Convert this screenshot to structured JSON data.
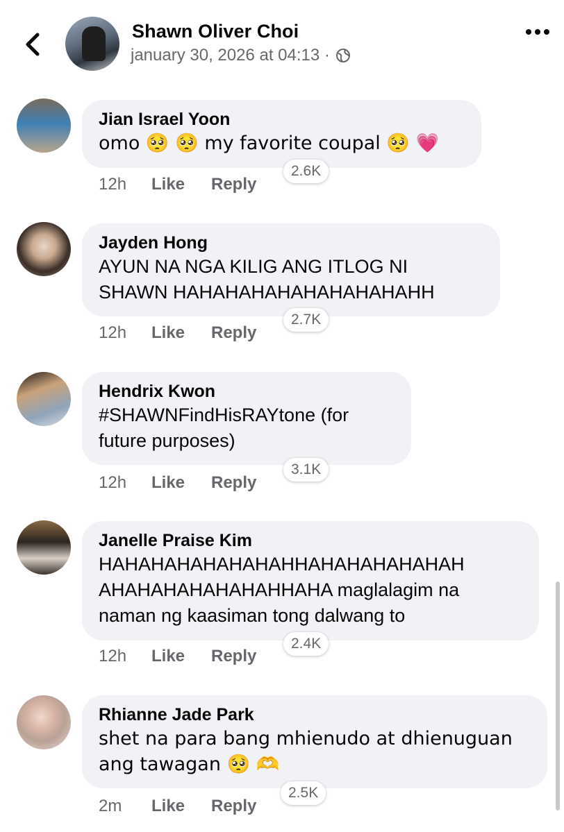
{
  "header": {
    "author_name": "Shawn Oliver Choi",
    "post_time": "january 30, 2026 at 04:13 ·",
    "audience_icon": "globe-icon",
    "back_icon": "chevron-left-icon",
    "more_icon": "more-horizontal-icon"
  },
  "actions": {
    "like_label": "Like",
    "reply_label": "Reply"
  },
  "comments": [
    {
      "name": "Jian Israel Yoon",
      "text": "omo 🥺 🥺  my favorite coupal 🥺 💗",
      "reactions": "2.6K",
      "time": "12h"
    },
    {
      "name": "Jayden Hong",
      "text": "AYUN NA NGA KILIG ANG ITLOG NI\nSHAWN HAHAHAHAHAHAHAHAHAHH",
      "reactions": "2.7K",
      "time": "12h"
    },
    {
      "name": "Hendrix Kwon",
      "text": "#SHAWNFindHisRAYtone (for\nfuture purposes)",
      "reactions": "3.1K",
      "time": "12h"
    },
    {
      "name": "Janelle Praise Kim",
      "text": "HAHAHAHAHAHAHAHHAHAHAHAHAHAH\nAHAHAHAHAHAHAHHAHA maglalagim na\nnaman ng kaasiman tong dalwang to",
      "reactions": "2.4K",
      "time": "12h"
    },
    {
      "name": "Rhianne Jade Park",
      "text": "shet na para bang mhienudo at dhienuguan\nang tawagan 🥺 🫶",
      "reactions": "2.5K",
      "time": "2m"
    }
  ],
  "colors": {
    "bubble": "#f0f2f5",
    "secondary_text": "#65676b",
    "primary_text": "#050505"
  }
}
